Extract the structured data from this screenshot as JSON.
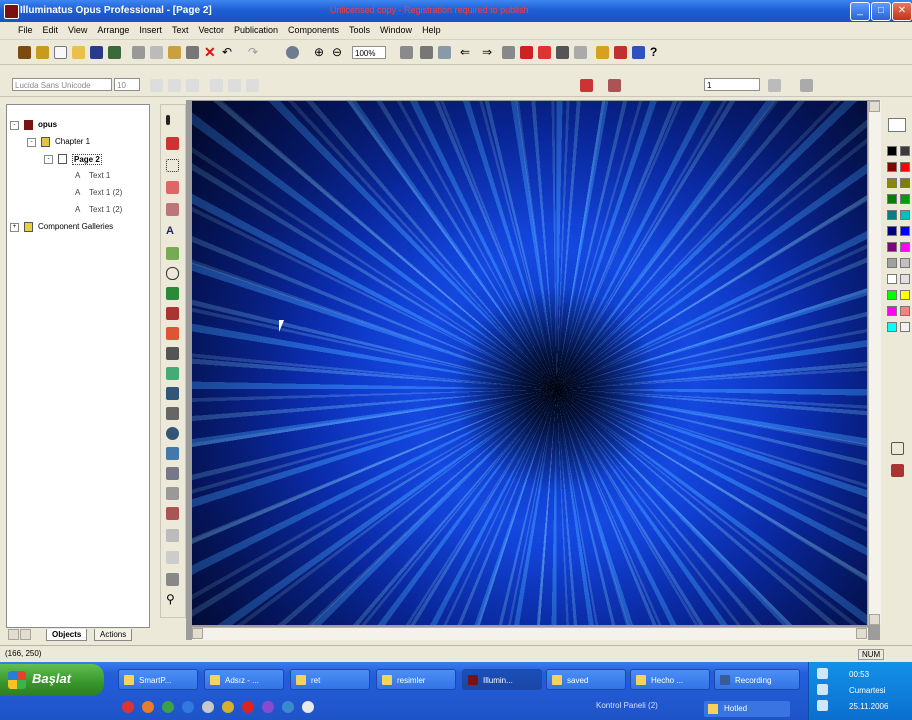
{
  "window": {
    "title": "Illuminatus Opus Professional - [Page 2]",
    "registration_notice": "Unlicensed copy - Registration required to publish",
    "controls": {
      "minimize": "_",
      "maximize": "□",
      "close": "✕"
    }
  },
  "menu": [
    "File",
    "Edit",
    "View",
    "Arrange",
    "Insert",
    "Text",
    "Vector",
    "Publication",
    "Components",
    "Tools",
    "Window",
    "Help"
  ],
  "toolbar2": {
    "zoom_value": "100%",
    "line_width": "1"
  },
  "toolbar3": {
    "font_name": "Lucida Sans Unicode",
    "font_size": "10"
  },
  "tree": {
    "items": [
      {
        "label": "opus",
        "level": 0,
        "expander": "-",
        "icon": "opus-book-icon"
      },
      {
        "label": "Chapter 1",
        "level": 1,
        "expander": "-",
        "icon": "chapter-icon"
      },
      {
        "label": "Page 2",
        "level": 2,
        "expander": "-",
        "icon": "page-icon"
      },
      {
        "label": "Text 1",
        "level": 3,
        "expander": "",
        "icon": "text-object-icon"
      },
      {
        "label": "Text 1 (2)",
        "level": 3,
        "expander": "",
        "icon": "text-object-icon"
      },
      {
        "label": "Text 1 (2)",
        "level": 3,
        "expander": "",
        "icon": "text-object-icon"
      },
      {
        "label": "Component Galleries",
        "level": 0,
        "expander": "+",
        "icon": "gallery-icon"
      }
    ],
    "tabs": [
      "Objects",
      "Actions"
    ]
  },
  "status": {
    "coordinates": "(166, 250)",
    "mode": "NUM"
  },
  "taskbar": {
    "start_label": "Başlat",
    "tasks": [
      {
        "label": "SmartP...",
        "active": false
      },
      {
        "label": "Adsız - ...",
        "active": false
      },
      {
        "label": "ret",
        "active": false
      },
      {
        "label": "resimler",
        "active": false
      },
      {
        "label": "Illumin...",
        "active": true
      },
      {
        "label": "saved",
        "active": false
      },
      {
        "label": "Hecho ...",
        "active": false
      },
      {
        "label": "Recording",
        "active": false
      }
    ],
    "row2_text": "Kontrol Paneli (2)",
    "row2_task": "Hotled",
    "tray": {
      "time": "00:53",
      "day": "Cumartesi",
      "date": "25.11.2006"
    }
  },
  "colors": {
    "palette": [
      "#000000",
      "#3a3a3a",
      "#8a0000",
      "#ff0000",
      "#8a8a00",
      "#808000",
      "#008000",
      "#00a000",
      "#008080",
      "#00c0c0",
      "#000080",
      "#0000ff",
      "#800080",
      "#ff00ff",
      "#a0a0a0",
      "#c0c0c0",
      "#ffffff",
      "#e0e0e0",
      "#00ff00",
      "#ffff00",
      "#ff00ff",
      "#ff8080",
      "#00ffff",
      "#f0f0f0"
    ]
  }
}
